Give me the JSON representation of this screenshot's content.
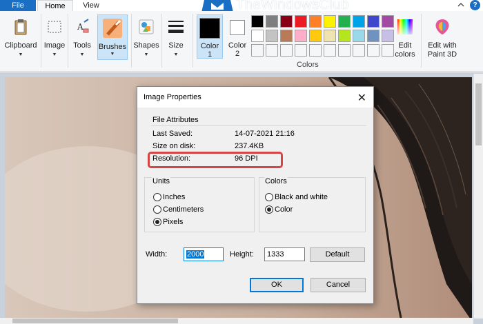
{
  "tabs": {
    "file": "File",
    "home": "Home",
    "view": "View"
  },
  "watermark": "TheWindowsClub",
  "ribbon": {
    "clipboard": "Clipboard",
    "image": "Image",
    "tools": "Tools",
    "brushes": "Brushes",
    "shapes": "Shapes",
    "size": "Size",
    "color1_line1": "Color",
    "color1_line2": "1",
    "color2_line1": "Color",
    "color2_line2": "2",
    "edit_colors_line1": "Edit",
    "edit_colors_line2": "colors",
    "paint3d_line1": "Edit with",
    "paint3d_line2": "Paint 3D",
    "colors_group": "Colors"
  },
  "colors": {
    "color1": "#000000",
    "color2": "#ffffff",
    "palette_row1": [
      "#000000",
      "#7f7f7f",
      "#880015",
      "#ed1c24",
      "#ff7f27",
      "#fff200",
      "#22b14c",
      "#00a2e8",
      "#3f48cc",
      "#a349a4"
    ],
    "palette_row2": [
      "#ffffff",
      "#c3c3c3",
      "#b97a57",
      "#ffaec9",
      "#ffc90e",
      "#efe4b0",
      "#b5e61d",
      "#99d9ea",
      "#7092be",
      "#c8bfe7"
    ],
    "highlight": "#d64545"
  },
  "dialog": {
    "title": "Image Properties",
    "file_attributes": "File Attributes",
    "last_saved_label": "Last Saved:",
    "last_saved_value": "14-07-2021 21:16",
    "size_label": "Size on disk:",
    "size_value": "237.4KB",
    "resolution_label": "Resolution:",
    "resolution_value": "96 DPI",
    "units_title": "Units",
    "units": [
      "Inches",
      "Centimeters",
      "Pixels"
    ],
    "units_selected": "Pixels",
    "colors_title": "Colors",
    "color_modes": [
      "Black and white",
      "Color"
    ],
    "color_selected": "Color",
    "width_label": "Width:",
    "width_value": "2000",
    "height_label": "Height:",
    "height_value": "1333",
    "default_button": "Default",
    "ok_button": "OK",
    "cancel_button": "Cancel"
  }
}
